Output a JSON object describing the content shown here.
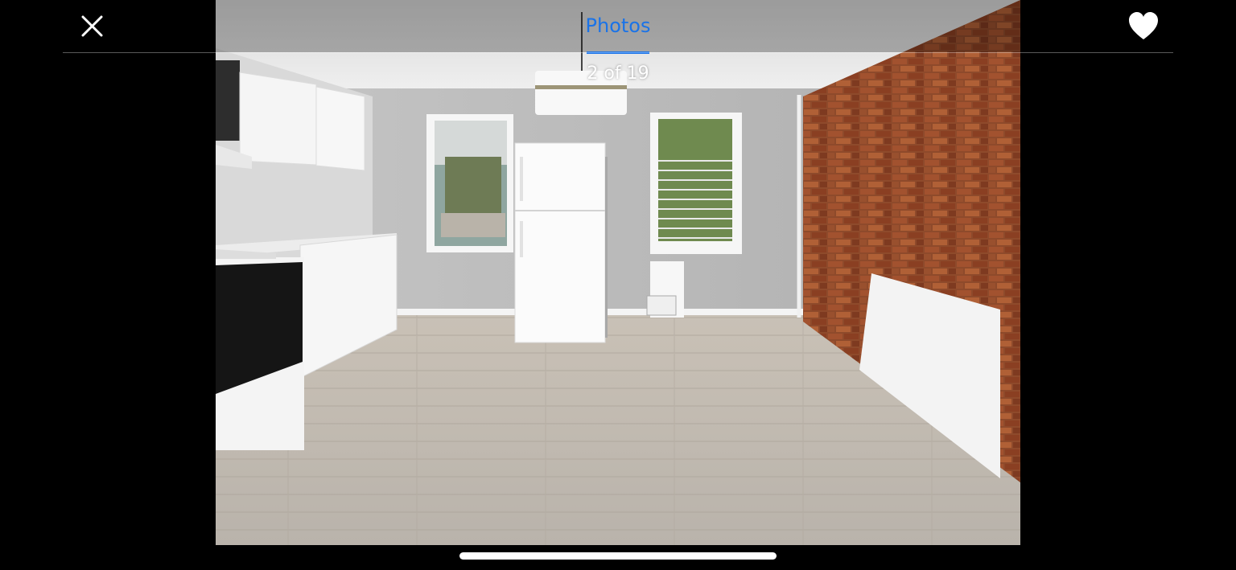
{
  "header": {
    "tab_label": "Photos",
    "counter": "2 of 19",
    "close_icon": "close-icon",
    "favorite_icon": "heart-icon"
  },
  "photo": {
    "position": 2,
    "total": 19
  },
  "colors": {
    "accent": "#1a73e8",
    "background": "#000000",
    "text": "#ffffff"
  }
}
